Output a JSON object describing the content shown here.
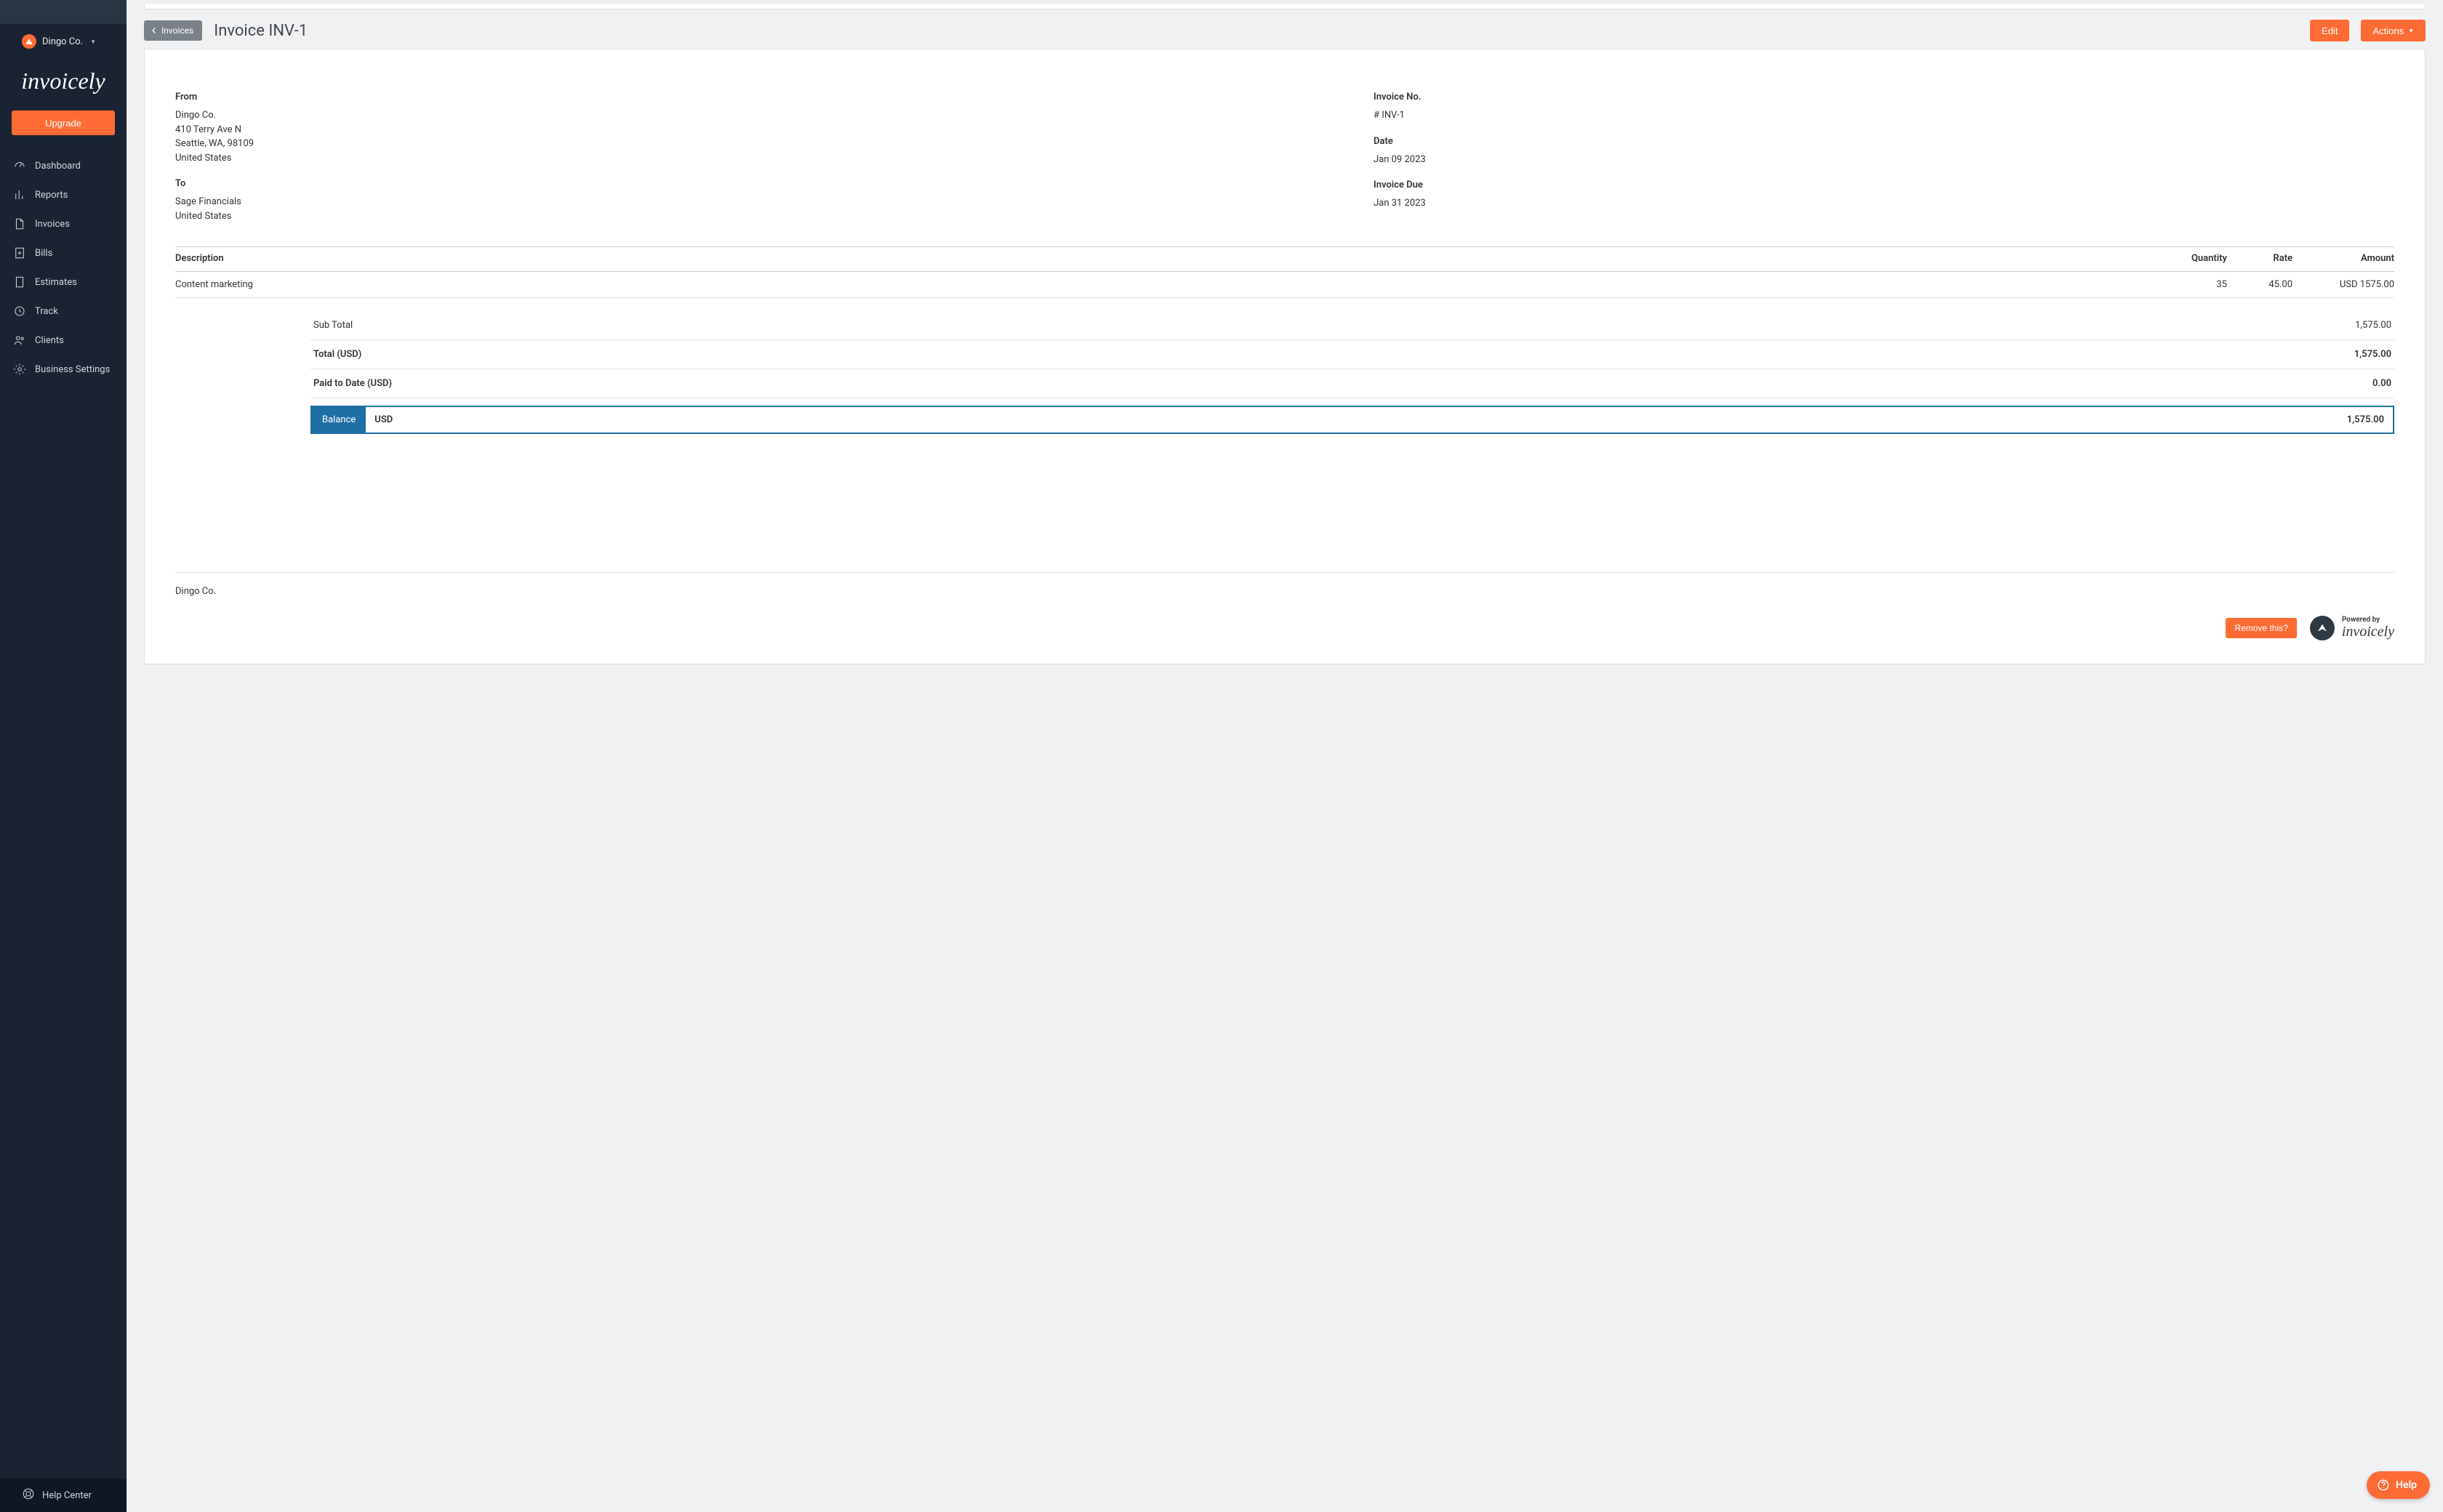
{
  "org": {
    "name": "Dingo Co."
  },
  "brand": "invoicely",
  "upgrade_label": "Upgrade",
  "nav": {
    "dashboard": "Dashboard",
    "reports": "Reports",
    "invoices": "Invoices",
    "bills": "Bills",
    "estimates": "Estimates",
    "track": "Track",
    "clients": "Clients",
    "business_settings": "Business Settings"
  },
  "help_center_label": "Help Center",
  "header": {
    "back_label": "Invoices",
    "title": "Invoice INV-1",
    "edit_label": "Edit",
    "actions_label": "Actions"
  },
  "invoice": {
    "from_title": "From",
    "from_name": "Dingo Co.",
    "from_addr1": "410 Terry Ave N",
    "from_addr2": "Seattle, WA, 98109",
    "from_country": "United States",
    "to_title": "To",
    "to_name": "Sage Financials",
    "to_country": "United States",
    "no_title": "Invoice No.",
    "no_value": "# INV-1",
    "date_title": "Date",
    "date_value": "Jan 09 2023",
    "due_title": "Invoice Due",
    "due_value": "Jan 31 2023",
    "columns": {
      "desc": "Description",
      "qty": "Quantity",
      "rate": "Rate",
      "amount": "Amount"
    },
    "line1": {
      "desc": "Content marketing",
      "qty": "35",
      "rate": "45.00",
      "amount": "USD 1575.00"
    },
    "totals": {
      "subtotal_label": "Sub Total",
      "subtotal_value": "1,575.00",
      "total_label": "Total (USD)",
      "total_value": "1,575.00",
      "paid_label": "Paid to Date (USD)",
      "paid_value": "0.00",
      "balance_label": "Balance",
      "balance_currency": "USD",
      "balance_value": "1,575.00"
    },
    "footer_company": "Dingo Co.",
    "remove_label": "Remove this?",
    "powered_by_label": "Powered by",
    "powered_by_brand": "invoicely"
  },
  "help_pill_label": "Help"
}
